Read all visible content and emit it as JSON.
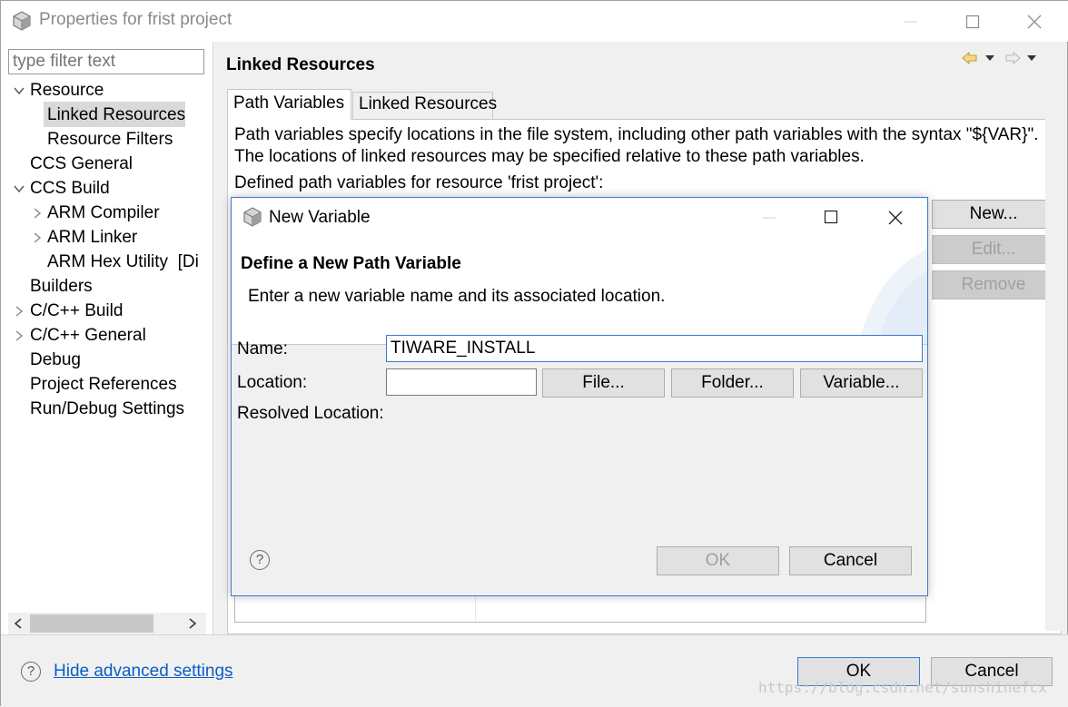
{
  "window": {
    "title": "Properties for frist project"
  },
  "left": {
    "filter_placeholder": "type filter text",
    "tree": [
      {
        "label": "Resource"
      },
      {
        "label": "Linked Resources"
      },
      {
        "label": "Resource Filters"
      },
      {
        "label": "CCS General"
      },
      {
        "label": "CCS Build"
      },
      {
        "label": "ARM Compiler"
      },
      {
        "label": "ARM Linker"
      },
      {
        "label": "ARM Hex Utility  [Di"
      },
      {
        "label": "Builders"
      },
      {
        "label": "C/C++ Build"
      },
      {
        "label": "C/C++ General"
      },
      {
        "label": "Debug"
      },
      {
        "label": "Project References"
      },
      {
        "label": "Run/Debug Settings"
      }
    ]
  },
  "page": {
    "title": "Linked Resources",
    "tabs": [
      {
        "label": "Path Variables"
      },
      {
        "label": "Linked Resources"
      }
    ],
    "description_line1": "Path variables specify locations in the file system, including other path variables with the syntax \"${VAR}\".",
    "description_line2": "The locations of linked resources may be specified relative to these path variables.",
    "defined_label": "Defined path variables for resource 'frist project':",
    "buttons": {
      "new": "New...",
      "edit": "Edit...",
      "remove": "Remove"
    }
  },
  "bottom": {
    "help_icon": "?",
    "hide_advanced": "Hide advanced settings",
    "ok": "OK",
    "cancel": "Cancel",
    "watermark": "https://blog.csdn.net/sunshinefcx"
  },
  "dialog": {
    "title": "New Variable",
    "heading": "Define a New Path Variable",
    "subheading": "Enter a new variable name and its associated location.",
    "name_label": "Name:",
    "name_value": "TIWARE_INSTALL",
    "location_label": "Location:",
    "location_value": "",
    "file_button": "File...",
    "folder_button": "Folder...",
    "variable_button": "Variable...",
    "resolved_label": "Resolved Location:",
    "help_icon": "?",
    "ok": "OK",
    "cancel": "Cancel"
  },
  "colors": {
    "accent": "#3a7bd5",
    "link": "#0a5ec4",
    "selection": "#d9d9d9"
  },
  "icons": [
    "app-cube-icon",
    "minimize-icon",
    "maximize-icon",
    "close-icon",
    "chevron-down-icon",
    "chevron-right-icon",
    "back-arrow-icon",
    "forward-arrow-icon",
    "view-menu-icon",
    "scroll-left-icon",
    "scroll-right-icon",
    "help-icon"
  ]
}
